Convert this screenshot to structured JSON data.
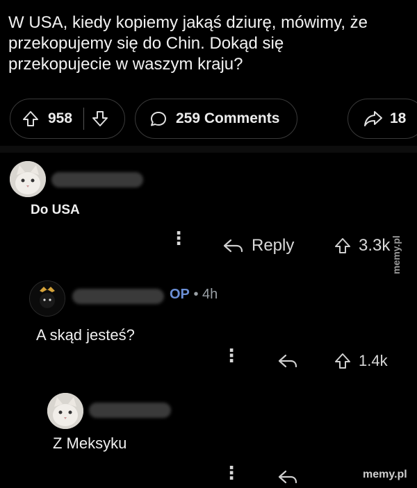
{
  "post": {
    "title": "W USA, kiedy kopiemy jakąś dziurę, mówimy, że\nprzekopujemy się do Chin. Dokąd się\nprzekopujecie w waszym kraju?",
    "upvotes": "958",
    "comments_label": "259 Comments",
    "shares": "18"
  },
  "comments": [
    {
      "text": "Do USA",
      "reply_label": "Reply",
      "score": "3.3k"
    },
    {
      "op_label": "OP",
      "time": "• 4h",
      "text": "A skąd jesteś?",
      "score": "1.4k"
    },
    {
      "text": "Z Meksyku"
    }
  ],
  "watermark": {
    "vertical": "memy.pl",
    "bottom": "memy.pl"
  },
  "colors": {
    "background": "#000000",
    "op_accent": "#6b8fd6"
  }
}
